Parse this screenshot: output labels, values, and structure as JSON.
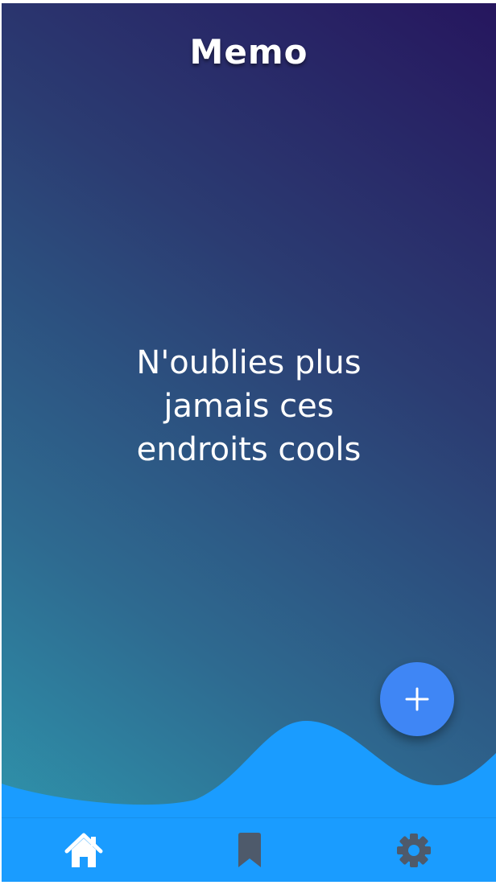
{
  "header": {
    "title": "Memo"
  },
  "main": {
    "tagline_lines": [
      "N'oublies plus",
      "jamais ces",
      "endroits cools"
    ]
  },
  "fab": {
    "icon": "plus-icon",
    "color": "#3f86f5"
  },
  "bottom_nav": {
    "color": "#1a9cff",
    "items": [
      {
        "icon": "home-icon",
        "active": true,
        "color": "#ffffff"
      },
      {
        "icon": "bookmark-icon",
        "active": false,
        "color": "#4e5a6b"
      },
      {
        "icon": "gear-icon",
        "active": false,
        "color": "#4e5a6b"
      }
    ]
  },
  "colors": {
    "gradient_top": "#26165e",
    "gradient_bottom": "#2f9bb0",
    "wave": "#1a9cff"
  }
}
